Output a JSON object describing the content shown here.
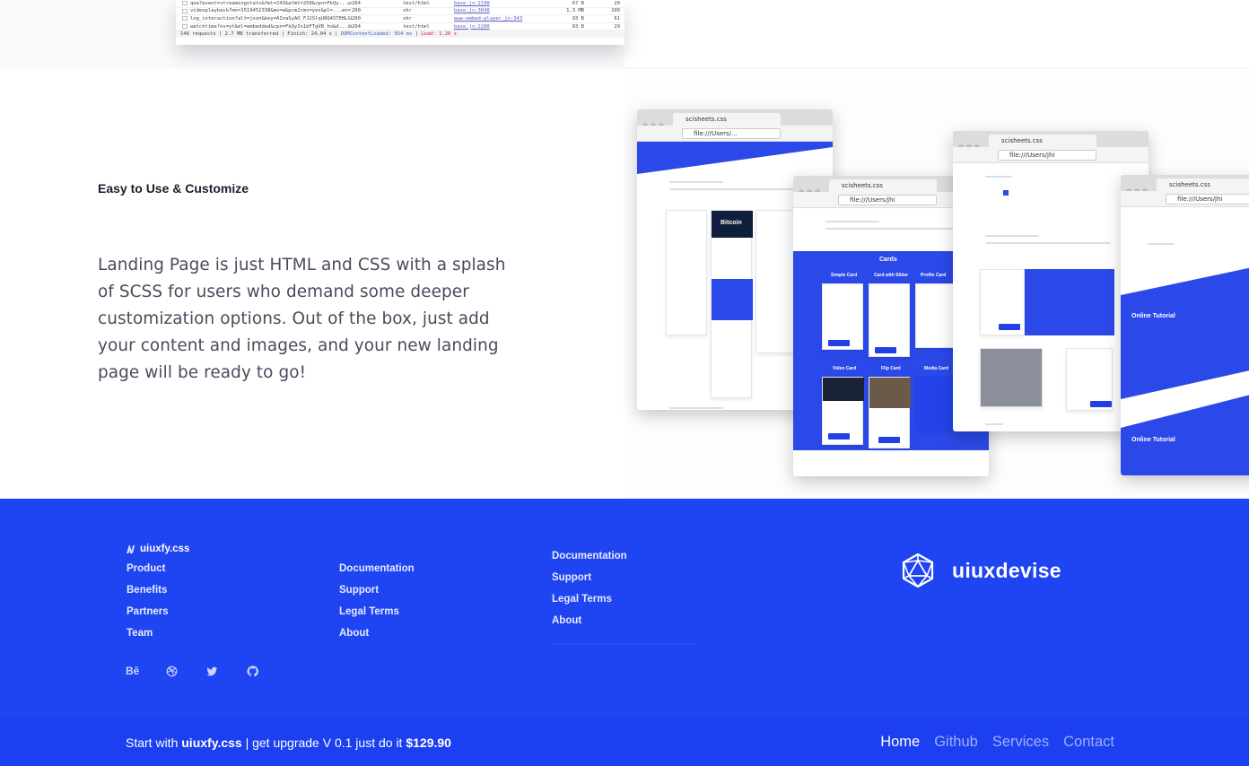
{
  "devtools": {
    "rows": [
      {
        "name": "qoe?event=streamingstats&fmt=243&afmt=250&cpn=FkQy...ws=1...",
        "status": "204",
        "type": "text/html",
        "initiator": "base.js:2198",
        "size": "67 B",
        "time": "29"
      },
      {
        "name": "videoplayback?mn=1519452338&mv=m&pcm2cms=yes&pl=...en=...",
        "status": "200",
        "type": "xhr",
        "initiator": "base.js:3048",
        "size": "1.3 MB",
        "time": "109"
      },
      {
        "name": "log_interaction?alt=json&key=AIzaSyAO_FJ2SlqU8Q4STEHLGCilw...",
        "status": "200",
        "type": "xhr",
        "initiator": "www-embed-player.js:343",
        "size": "93 B",
        "time": "61"
      },
      {
        "name": "watchtime?ns=yt&el=embedded&cpn=FkQyIn1bFTgVB_ho&d...doj...",
        "status": "204",
        "type": "text/html",
        "initiator": "base.js:2200",
        "size": "83 B",
        "time": "29"
      }
    ],
    "status_prefix": "146 requests | 2.7 MB transferred | Finish: 24.04 s |",
    "status_dom": "DOMContentLoaded: 954 ms",
    "status_load": "Load: 1.20 s"
  },
  "feature": {
    "title": "Easy to Use & Customize",
    "body": "Landing Page is just HTML and CSS with a splash of SCSS for users who demand some deeper customization options. Out of the box, just add your content and images, and your new landing page will be ready to go!"
  },
  "mockups": {
    "tab_label": "scisheets.css",
    "url": "file:///Users/...",
    "url_short": "file:///Users/jhi",
    "cards_heading": "Cards",
    "card_titles": [
      "Simple Card",
      "Card with Slider",
      "Profile Card",
      "Video Card",
      "Flip Card",
      "Media Card"
    ],
    "tutorial_title": "Online Tutorial",
    "bitcoin_label": "Bitcoin"
  },
  "footer": {
    "brand_small": "uiuxfy.css",
    "col1": [
      "Product",
      "Benefits",
      "Partners",
      "Team"
    ],
    "col2": [
      "Documentation",
      "Support",
      "Legal Terms",
      "About"
    ],
    "col3": [
      "Documentation",
      "Support",
      "Legal Terms",
      "About"
    ],
    "socials": {
      "behance": "Bē"
    },
    "logo_name": "uiuxdevise"
  },
  "bottom": {
    "start_with": "Start with ",
    "product": "uiuxfy.css",
    "upgrade": " | get upgrade V 0.1 just do it ",
    "price": "$129.90",
    "nav": [
      "Home",
      "Github",
      "Services",
      "Contact"
    ]
  },
  "colors": {
    "footer_blue": "#1f44f2",
    "bottom_bar_blue": "#1c3ff0",
    "nav_inactive": "#9cb0ff",
    "text_dark": "#1d1d2b",
    "body_text": "#4a4a5c"
  }
}
